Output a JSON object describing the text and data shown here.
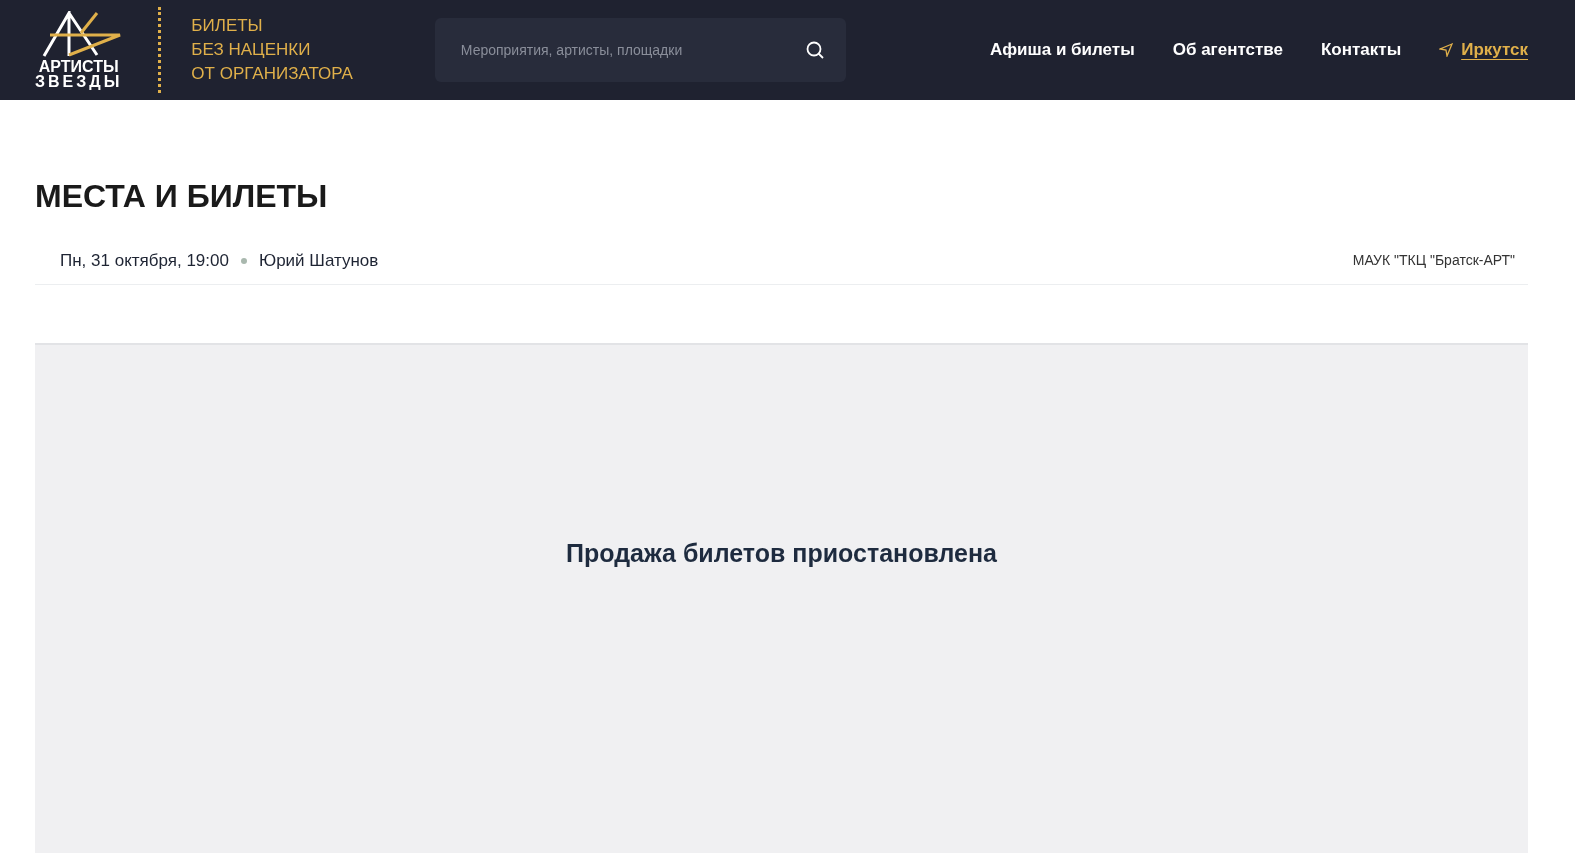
{
  "header": {
    "logo_text": [
      "АРТИСТЫ",
      "ЗВЕЗДЫ"
    ],
    "slogan": [
      "БИЛЕТЫ",
      "БЕЗ НАЦЕНКИ",
      "ОТ ОРГАНИЗАТОРА"
    ],
    "search": {
      "placeholder": "Мероприятия, артисты, площадки"
    },
    "nav": [
      {
        "label": "Афиша и билеты",
        "kind": "link"
      },
      {
        "label": "Об агентстве",
        "kind": "link"
      },
      {
        "label": "Контакты",
        "kind": "link"
      },
      {
        "label": "Иркутск",
        "kind": "city"
      }
    ]
  },
  "page": {
    "title": "МЕСТА И БИЛЕТЫ",
    "event": {
      "date": "Пн, 31 октября, 19:00",
      "artist": "Юрий Шатунов",
      "venue": "МАУК \"ТКЦ \"Братск-АРТ\""
    },
    "notice": "Продажа билетов приостановлена"
  }
}
